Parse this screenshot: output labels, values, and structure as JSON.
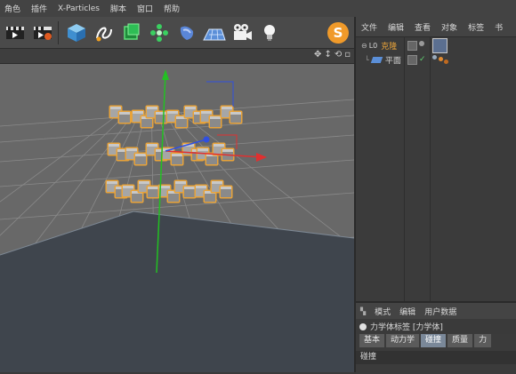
{
  "menubar": {
    "items": [
      "角色",
      "插件",
      "X-Particles",
      "脚本",
      "窗口",
      "帮助"
    ]
  },
  "toolbar": {
    "icons": [
      "render-view-icon",
      "render-settings-icon",
      "cube-icon",
      "spline-pen-icon",
      "cloner-icon",
      "array-icon",
      "deformer-icon",
      "floor-icon",
      "camera-icon",
      "light-bulb-icon"
    ]
  },
  "object_manager": {
    "menu": [
      "文件",
      "编辑",
      "查看",
      "对象",
      "标签",
      "书"
    ],
    "objects": [
      {
        "name": "克隆",
        "prefix": "L0",
        "color": "#e8a33a"
      },
      {
        "name": "平面",
        "prefix": "",
        "color": "#d8d8d8"
      }
    ]
  },
  "attributes": {
    "menu": [
      "模式",
      "编辑",
      "用户数据"
    ],
    "title": "力学体标签 [力学体]",
    "tabs": [
      "基本",
      "动力学",
      "碰撞",
      "质量",
      "力"
    ],
    "active_tab": "碰撞",
    "section": "碰撞"
  },
  "colors": {
    "selected_highlight": "#e8a33a",
    "axis_x": "#e03030",
    "axis_y": "#22c022",
    "axis_z": "#3050e0",
    "grid": "#8a8a8a",
    "plane": "#3f454d"
  }
}
